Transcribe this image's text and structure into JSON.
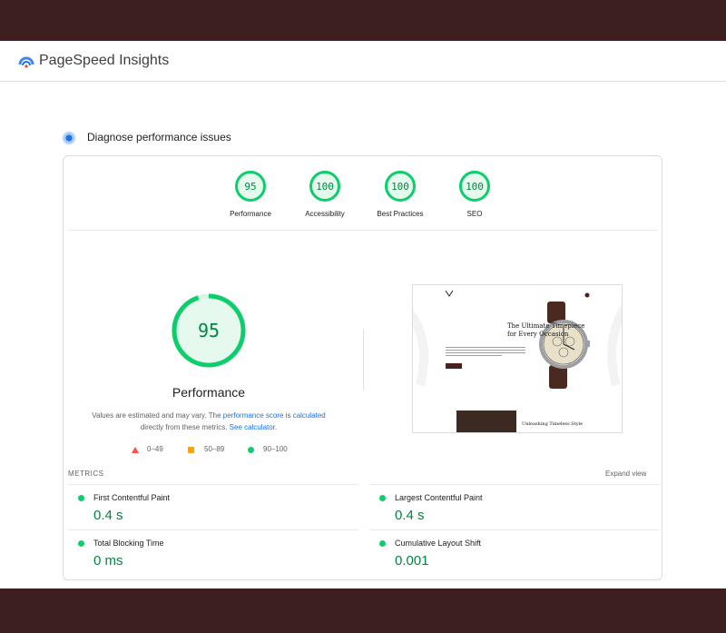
{
  "app": {
    "title": "PageSpeed Insights"
  },
  "section": {
    "title": "Diagnose performance issues"
  },
  "categories": [
    {
      "label": "Performance",
      "score": "95"
    },
    {
      "label": "Accessibility",
      "score": "100"
    },
    {
      "label": "Best Practices",
      "score": "100"
    },
    {
      "label": "SEO",
      "score": "100"
    }
  ],
  "performance": {
    "score": "95",
    "score_fraction": 0.95,
    "label": "Performance",
    "note_prefix": "Values are estimated and may vary. The",
    "note_link1": "performance score is calculated",
    "note_middle": "directly from these metrics.",
    "note_link2": "See calculator."
  },
  "legend": {
    "fail": "0–49",
    "average": "50–89",
    "pass": "90–100"
  },
  "screenshot": {
    "headline": "The Ultimate Timepiece for Every Occasion",
    "caption": "Unleashing Timeless Style"
  },
  "metrics": {
    "title": "METRICS",
    "expand_label": "Expand view",
    "items": [
      {
        "name": "First Contentful Paint",
        "value": "0.4 s"
      },
      {
        "name": "Largest Contentful Paint",
        "value": "0.4 s"
      },
      {
        "name": "Total Blocking Time",
        "value": "0 ms"
      },
      {
        "name": "Cumulative Layout Shift",
        "value": "0.001"
      }
    ]
  },
  "colors": {
    "pass": "#0cce6b",
    "pass_text": "#018642",
    "fail": "#ff4e42",
    "average": "#ffa400",
    "link": "#1a73e8",
    "band": "#3e1f20"
  }
}
